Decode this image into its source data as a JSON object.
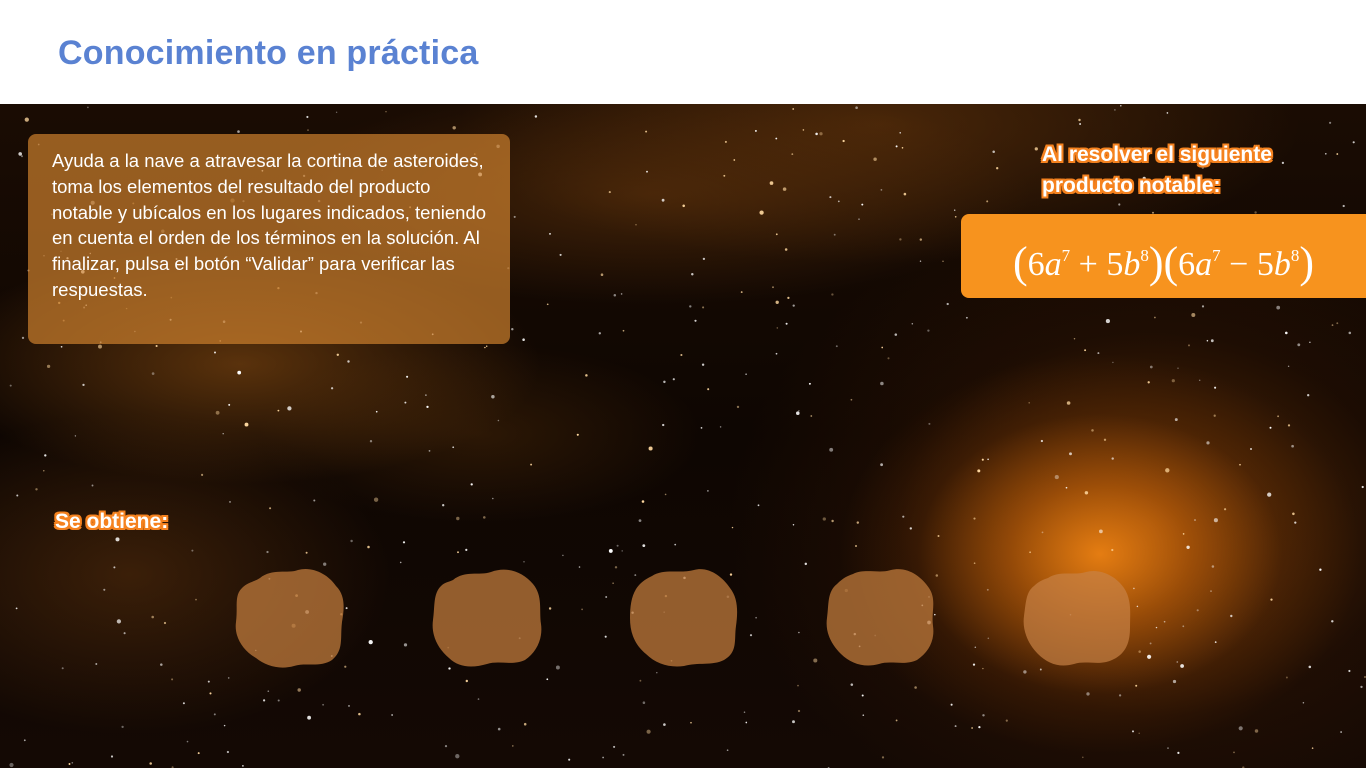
{
  "header": {
    "title": "Conocimiento en práctica"
  },
  "instructions": {
    "text": "Ayuda a la nave a atravesar la cortina de asteroides, toma los elementos del resultado del producto notable y ubícalos en los lugares indicados, teniendo en cuenta el orden de los términos en la solución. Al finalizar, pulsa el botón “Validar” para verificar las respuestas."
  },
  "prompt": {
    "label_line1": "Al resolver el siguiente",
    "label_line2": "producto notable:"
  },
  "expression": {
    "open_paren": "(",
    "close_paren": ")",
    "factor1": {
      "coef1": "6",
      "var1": "a",
      "exp1": "7",
      "operator": "+",
      "coef2": "5",
      "var2": "b",
      "exp2": "8"
    },
    "factor2": {
      "coef1": "6",
      "var1": "a",
      "exp1": "7",
      "operator": "−",
      "coef2": "5",
      "var2": "b",
      "exp2": "8"
    }
  },
  "result": {
    "label": "Se obtiene:",
    "drop_zone_count": 5,
    "drop_zone_color": "#b8763a"
  },
  "colors": {
    "title_blue": "#5a82d2",
    "accent_orange": "#f7931e",
    "outline_orange": "#f5821f"
  }
}
